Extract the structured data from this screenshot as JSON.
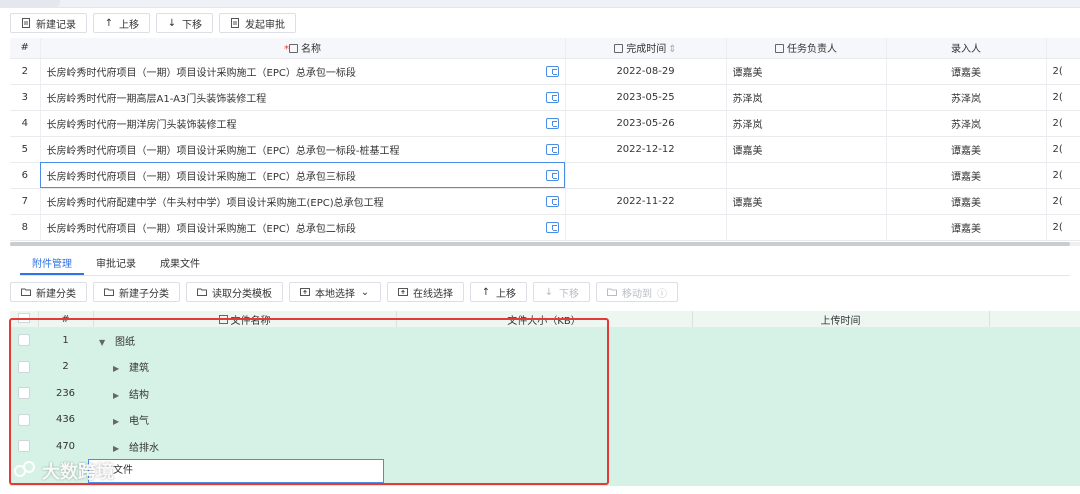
{
  "toolbar_top": {
    "buttons": [
      {
        "label": "新建记录",
        "icon": "document-icon"
      },
      {
        "label": "上移",
        "icon": "arrow-up-icon"
      },
      {
        "label": "下移",
        "icon": "arrow-down-icon"
      },
      {
        "label": "发起审批",
        "icon": "document-icon"
      }
    ]
  },
  "records_table": {
    "headers": {
      "index": "#",
      "name_required_mark": "*",
      "name": "名称",
      "completion_time": "完成时间",
      "owner": "任务负责人",
      "entered_by": "录入人",
      "overflow": ""
    },
    "rows": [
      {
        "no": "2",
        "name": "长房岭秀时代府项目（一期）项目设计采购施工（EPC）总承包一标段",
        "date": "2022-08-29",
        "owner": "谭嘉美",
        "entered_by": "谭嘉美",
        "overflow": "2("
      },
      {
        "no": "3",
        "name": "长房岭秀时代府一期高层A1-A3门头装饰装修工程",
        "date": "2023-05-25",
        "owner": "苏泽岚",
        "entered_by": "苏泽岚",
        "overflow": "2("
      },
      {
        "no": "4",
        "name": "长房岭秀时代府一期洋房门头装饰装修工程",
        "date": "2023-05-26",
        "owner": "苏泽岚",
        "entered_by": "苏泽岚",
        "overflow": "2("
      },
      {
        "no": "5",
        "name": "长房岭秀时代府项目（一期）项目设计采购施工（EPC）总承包一标段-桩基工程",
        "date": "2022-12-12",
        "owner": "谭嘉美",
        "entered_by": "谭嘉美",
        "overflow": "2("
      },
      {
        "no": "6",
        "name": "长房岭秀时代府项目（一期）项目设计采购施工（EPC）总承包三标段",
        "date": "",
        "owner": "",
        "entered_by": "谭嘉美",
        "overflow": "2("
      },
      {
        "no": "7",
        "name": "长房岭秀时代府配建中学（牛头村中学）项目设计采购施工(EPC)总承包工程",
        "date": "2022-11-22",
        "owner": "谭嘉美",
        "entered_by": "谭嘉美",
        "overflow": "2("
      },
      {
        "no": "8",
        "name": "长房岭秀时代府项目（一期）项目设计采购施工（EPC）总承包二标段",
        "date": "",
        "owner": "",
        "entered_by": "谭嘉美",
        "overflow": "2("
      }
    ]
  },
  "tabs": [
    {
      "label": "附件管理",
      "active": true
    },
    {
      "label": "审批记录",
      "active": false
    },
    {
      "label": "成果文件",
      "active": false
    }
  ],
  "toolbar_attach": {
    "buttons": [
      {
        "label": "新建分类",
        "icon": "folder-icon",
        "disabled": false
      },
      {
        "label": "新建子分类",
        "icon": "folder-icon",
        "disabled": false
      },
      {
        "label": "读取分类模板",
        "icon": "folder-icon",
        "disabled": false
      },
      {
        "label": "本地选择",
        "icon": "upload-icon",
        "disabled": false,
        "dropdown": true
      },
      {
        "label": "在线选择",
        "icon": "upload-icon",
        "disabled": false
      },
      {
        "label": "上移",
        "icon": "arrow-up-icon",
        "disabled": false
      },
      {
        "label": "下移",
        "icon": "arrow-down-icon",
        "disabled": true
      },
      {
        "label": "移动到",
        "icon": "folder-icon",
        "disabled": true,
        "info": true
      }
    ]
  },
  "files_table": {
    "headers": {
      "index": "#",
      "name": "文件名称",
      "size": "文件大小（KB）",
      "upload_time": "上传时间"
    },
    "rows": [
      {
        "no": "1",
        "name": "图纸",
        "expanded": true,
        "level": 0
      },
      {
        "no": "2",
        "name": "建筑",
        "expanded": false,
        "level": 1
      },
      {
        "no": "236",
        "name": "结构",
        "expanded": false,
        "level": 1
      },
      {
        "no": "436",
        "name": "电气",
        "expanded": false,
        "level": 1
      },
      {
        "no": "470",
        "name": "给排水",
        "expanded": false,
        "level": 1
      }
    ],
    "editing_row_text": "文件"
  },
  "watermark": "大数跨境",
  "colors": {
    "accent": "#2f74e5",
    "highlight": "#d6f2e6",
    "annotation": "#e53935"
  }
}
